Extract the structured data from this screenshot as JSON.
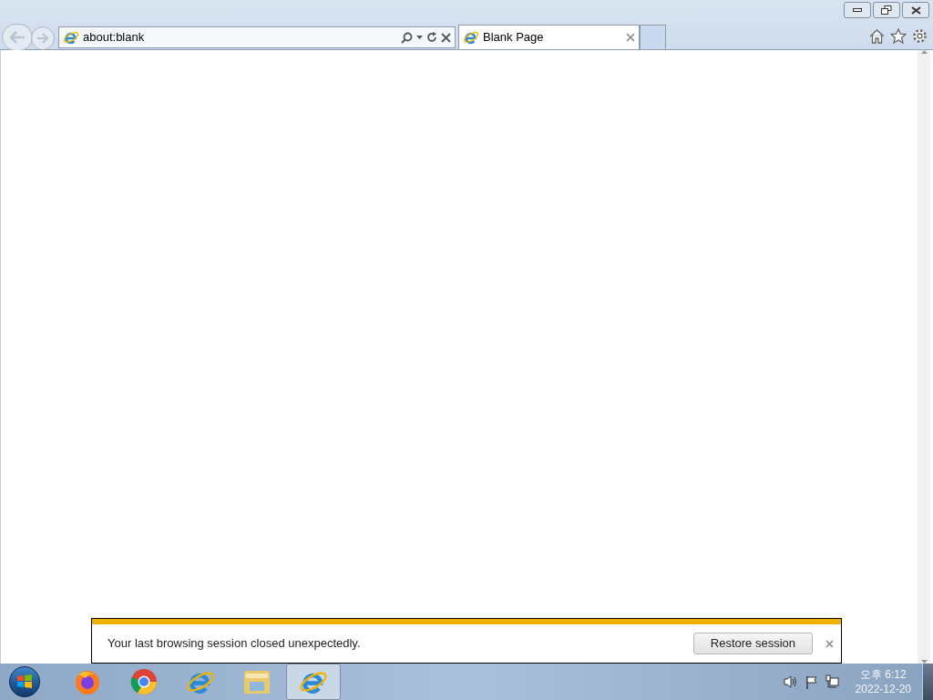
{
  "address_bar": {
    "url": "about:blank"
  },
  "tabs": [
    {
      "title": "Blank Page",
      "selected": true
    }
  ],
  "notification": {
    "message": "Your last browsing session closed unexpectedly.",
    "button": "Restore session"
  },
  "taskbar": {
    "apps": [
      {
        "kind": "firefox",
        "selected": false
      },
      {
        "kind": "chrome",
        "selected": false
      },
      {
        "kind": "ie",
        "selected": false
      },
      {
        "kind": "explorer",
        "selected": false
      },
      {
        "kind": "ie",
        "selected": true
      }
    ],
    "clock": {
      "time": "오후 6:12",
      "date": "2022-12-20"
    }
  }
}
